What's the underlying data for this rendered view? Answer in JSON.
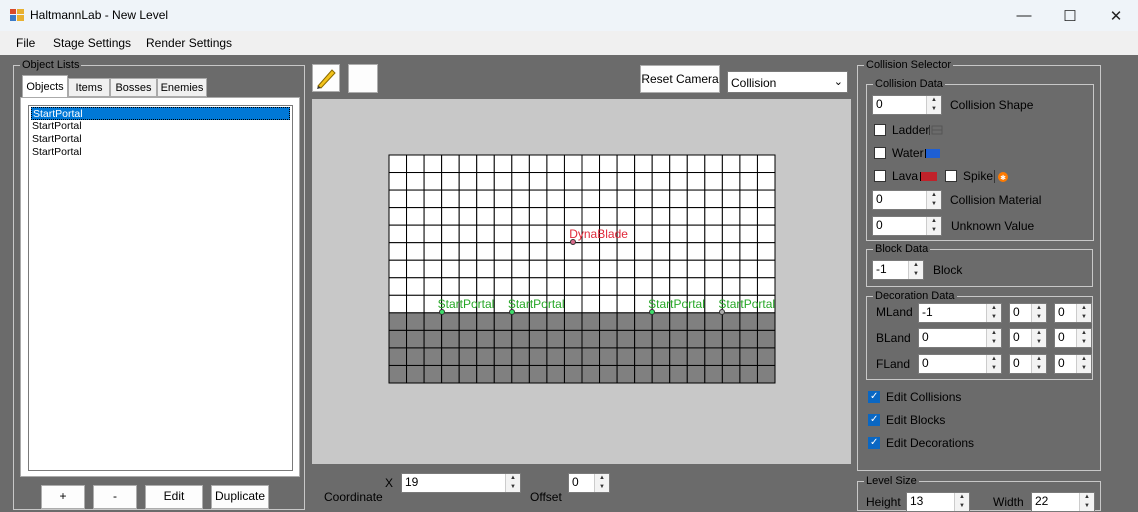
{
  "window": {
    "title": "HaltmannLab - New Level",
    "minimize_glyph": "—",
    "maximize_glyph": "☐",
    "close_glyph": "✕"
  },
  "menu": [
    "File",
    "Stage Settings",
    "Render Settings"
  ],
  "object_lists": {
    "title": "Object Lists",
    "tabs": [
      "Objects",
      "Items",
      "Bosses",
      "Enemies"
    ],
    "active_tab": "Objects",
    "items": [
      "StartPortal",
      "StartPortal",
      "StartPortal",
      "StartPortal"
    ],
    "selected_index": 0,
    "buttons": {
      "add": "+",
      "remove": "-",
      "edit": "Edit",
      "duplicate": "Duplicate"
    }
  },
  "toolbar": {
    "pencil_icon": "pencil-icon",
    "reset_camera": "Reset Camera",
    "mode_select": "Collision"
  },
  "canvas": {
    "grid_cols": 22,
    "grid_rows": 13,
    "ground_rows": 4,
    "colors": {
      "background": "#c8c8c8",
      "cell": "#ffffff",
      "ground": "#808080",
      "grid_line": "#000000"
    },
    "objects": [
      {
        "label": "DynaBlade",
        "col": 10.5,
        "row": 5,
        "color": "#e0293a",
        "marker": "#d86a8a"
      },
      {
        "label": "StartPortal",
        "col": 3,
        "row": 9,
        "color": "#27a827",
        "marker": "#3ddc6a"
      },
      {
        "label": "StartPortal",
        "col": 7,
        "row": 9,
        "color": "#27a827",
        "marker": "#3ddc6a"
      },
      {
        "label": "StartPortal",
        "col": 15,
        "row": 9,
        "color": "#27a827",
        "marker": "#3ddc6a"
      },
      {
        "label": "StartPortal",
        "col": 19,
        "row": 9,
        "color": "#27a827",
        "marker": "#aaaaaa"
      }
    ]
  },
  "bottom": {
    "coordinate_label": "Coordinate",
    "x_label": "X",
    "x_value": "19",
    "offset_label": "Offset",
    "offset_value": "0"
  },
  "collision_selector": {
    "title": "Collision Selector",
    "collision_data": {
      "title": "Collision Data",
      "shape_value": "0",
      "shape_label": "Collision Shape",
      "ladder": "Ladder",
      "water": "Water",
      "lava": "Lava",
      "spike": "Spike",
      "material_value": "0",
      "material_label": "Collision Material",
      "unknown_value": "0",
      "unknown_label": "Unknown Value",
      "colors": {
        "water": "#1e5fd4",
        "lava": "#c0222a",
        "spike": "#ff7a00"
      }
    },
    "block_data": {
      "title": "Block Data",
      "value": "-1",
      "label": "Block"
    },
    "decoration_data": {
      "title": "Decoration Data",
      "rows": [
        {
          "label": "MLand",
          "v1": "-1",
          "v2": "0",
          "v3": "0"
        },
        {
          "label": "BLand",
          "v1": "0",
          "v2": "0",
          "v3": "0"
        },
        {
          "label": "FLand",
          "v1": "0",
          "v2": "0",
          "v3": "0"
        }
      ]
    },
    "edit_collisions": "Edit Collisions",
    "edit_blocks": "Edit Blocks",
    "edit_decorations": "Edit Decorations"
  },
  "level_size": {
    "title": "Level Size",
    "height_label": "Height",
    "height_value": "13",
    "width_label": "Width",
    "width_value": "22"
  }
}
